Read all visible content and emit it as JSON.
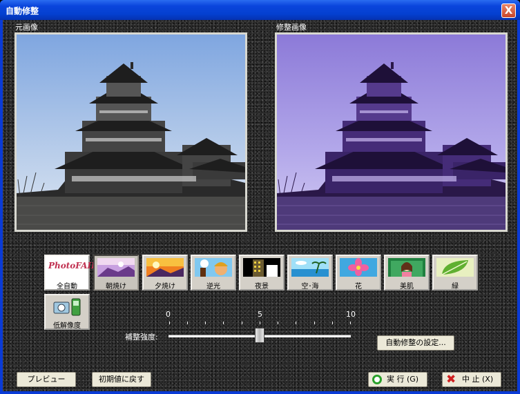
{
  "window": {
    "title": "自動修整",
    "close_glyph": "X"
  },
  "images": {
    "original_label": "元画像",
    "corrected_label": "修整画像"
  },
  "modes": [
    {
      "label": "全自動",
      "logo_text": "PhotoFAIR",
      "selected": false
    },
    {
      "label": "朝焼け",
      "selected": true
    },
    {
      "label": "夕焼け",
      "selected": false
    },
    {
      "label": "逆光",
      "selected": false
    },
    {
      "label": "夜景",
      "selected": false
    },
    {
      "label": "空･海",
      "selected": false
    },
    {
      "label": "花",
      "selected": false
    },
    {
      "label": "美肌",
      "selected": false
    },
    {
      "label": "緑",
      "selected": false
    },
    {
      "label": "低解像度",
      "selected": false
    }
  ],
  "slider": {
    "label": "補整強度:",
    "min_label": "0",
    "mid_label": "5",
    "max_label": "10",
    "min": 0,
    "max": 10,
    "value": 5
  },
  "buttons": {
    "settings": "自動修整の設定...",
    "preview": "プレビュー",
    "reset": "初期値に戻す",
    "run": "実 行 (G)",
    "cancel": "中 止 (X)"
  },
  "colors": {
    "titlebar": "#0a45dc",
    "panel": "#d4d0c8",
    "run_icon": "#2aa02a",
    "cancel_icon": "#d02020"
  }
}
